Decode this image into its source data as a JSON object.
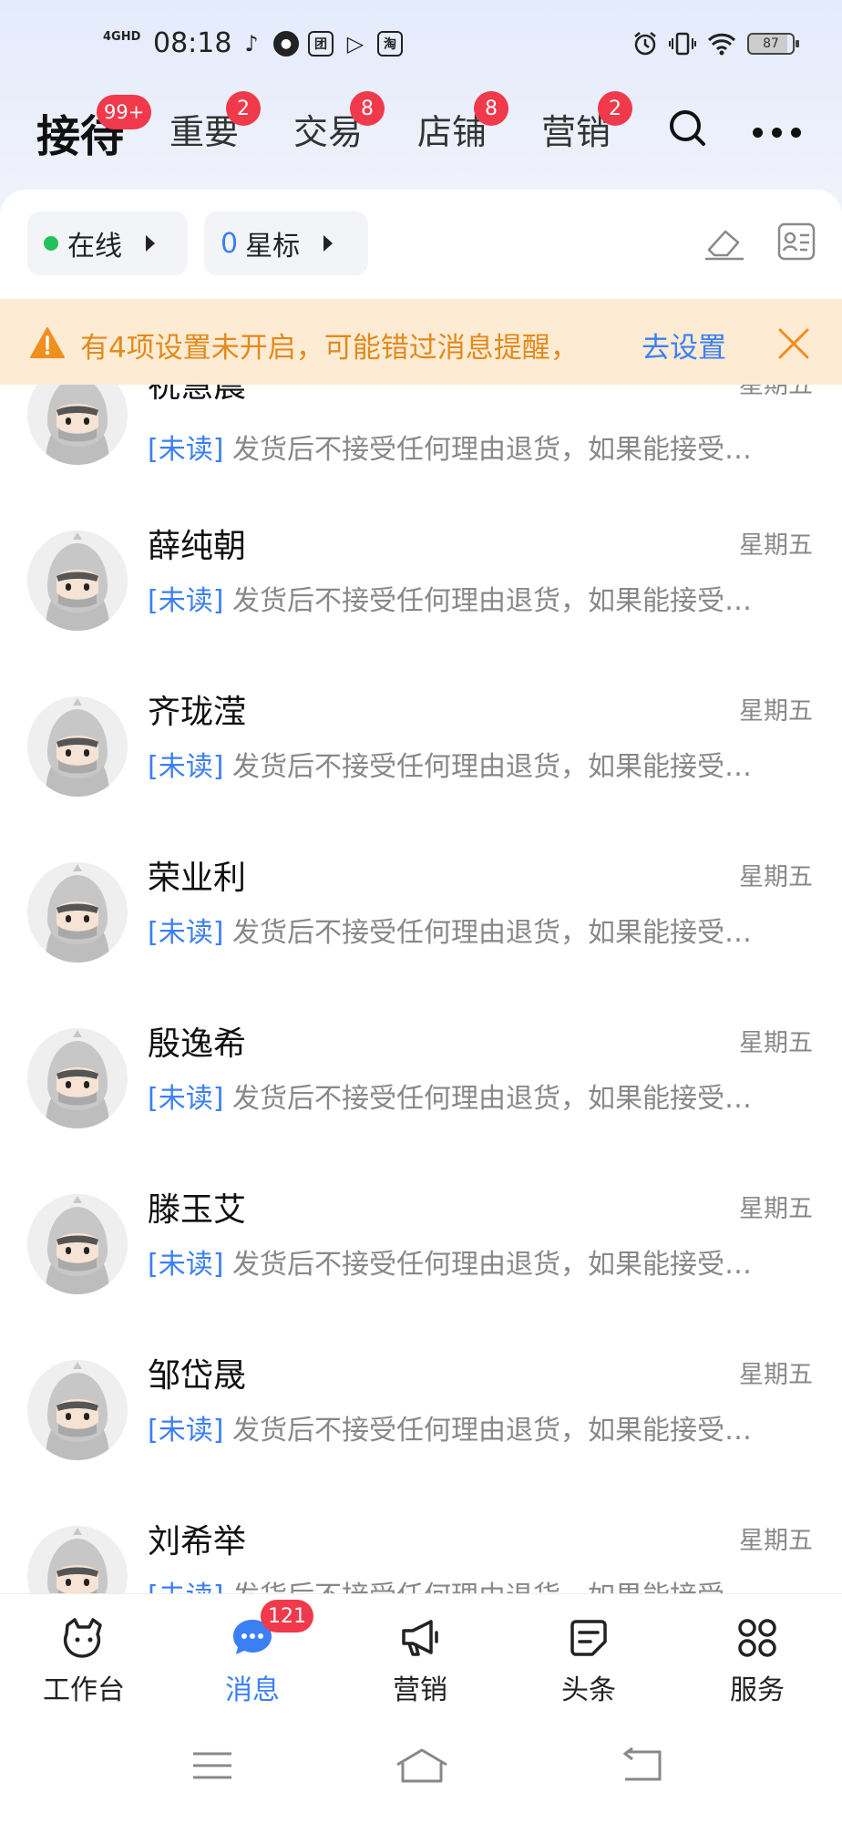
{
  "status_bar": {
    "signal": "4GHD",
    "time": "08:18",
    "apps": [
      "♪",
      "●",
      "团",
      "▷",
      "淘"
    ],
    "battery": "87"
  },
  "tabs": [
    {
      "label": "接待",
      "badge": "99+",
      "active": true
    },
    {
      "label": "重要",
      "badge": "2"
    },
    {
      "label": "交易",
      "badge": "8"
    },
    {
      "label": "店铺",
      "badge": "8"
    },
    {
      "label": "营销",
      "badge": "2"
    }
  ],
  "filters": {
    "online_label": "在线",
    "star_count": "0",
    "star_label": "星标"
  },
  "notice": {
    "text": "有4项设置未开启，可能错过消息提醒，",
    "link": "去设置"
  },
  "conversations": [
    {
      "name": "祝慧晨",
      "time": "星期五",
      "unread_tag": "[未读]",
      "preview": " 发货后不接受任何理由退货，如果能接受…"
    },
    {
      "name": "薛纯朝",
      "time": "星期五",
      "unread_tag": "[未读]",
      "preview": " 发货后不接受任何理由退货，如果能接受…"
    },
    {
      "name": "齐珑滢",
      "time": "星期五",
      "unread_tag": "[未读]",
      "preview": " 发货后不接受任何理由退货，如果能接受…"
    },
    {
      "name": "荣业利",
      "time": "星期五",
      "unread_tag": "[未读]",
      "preview": " 发货后不接受任何理由退货，如果能接受…"
    },
    {
      "name": "殷逸希",
      "time": "星期五",
      "unread_tag": "[未读]",
      "preview": " 发货后不接受任何理由退货，如果能接受…"
    },
    {
      "name": "滕玉艾",
      "time": "星期五",
      "unread_tag": "[未读]",
      "preview": " 发货后不接受任何理由退货，如果能接受…"
    },
    {
      "name": "邹岱晟",
      "time": "星期五",
      "unread_tag": "[未读]",
      "preview": " 发货后不接受任何理由退货，如果能接受…"
    },
    {
      "name": "刘希举",
      "time": "星期五",
      "unread_tag": "[未读]",
      "preview": " 发货后不接受任何理由退货，如果能接受…"
    }
  ],
  "bottom_nav": [
    {
      "label": "工作台"
    },
    {
      "label": "消息",
      "badge": "121",
      "active": true
    },
    {
      "label": "营销"
    },
    {
      "label": "头条"
    },
    {
      "label": "服务"
    }
  ],
  "colors": {
    "accent": "#3b7ff5",
    "badge": "#f0394a",
    "notice_bg": "#fdebd3",
    "notice_text": "#e28a1d",
    "online": "#22c25a"
  }
}
